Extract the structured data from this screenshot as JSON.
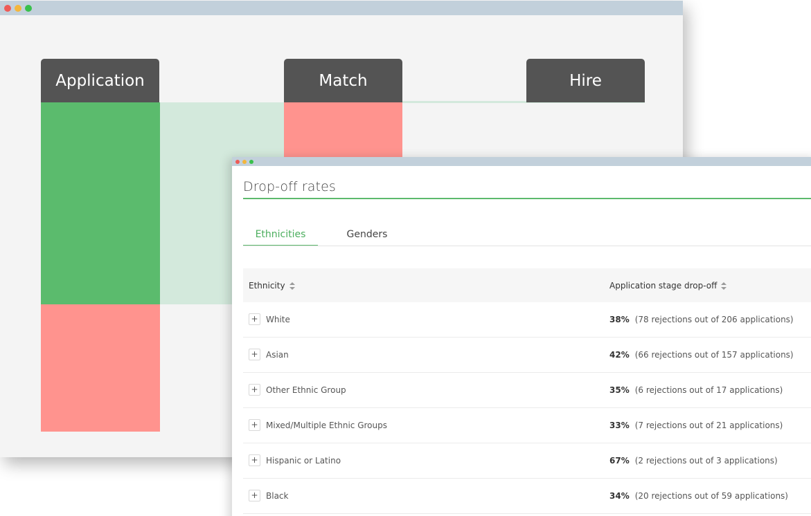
{
  "back_window": {
    "controls": {
      "close_color": "#ee5b57",
      "minimize_color": "#f4b63c",
      "zoom_color": "#39c04c"
    },
    "stages": [
      "Application",
      "Match",
      "Hire"
    ],
    "colors": {
      "tab": "#545454",
      "pass": "#5bbb6d",
      "flow": "#d3e9dc",
      "drop": "#ff938e"
    }
  },
  "front_window": {
    "title": "Drop-off rates",
    "tabs": [
      {
        "label": "Ethnicities",
        "active": true
      },
      {
        "label": "Genders",
        "active": false
      }
    ],
    "table": {
      "columns": [
        "Ethnicity",
        "Application stage drop-off"
      ],
      "expand_glyph": "+",
      "rows": [
        {
          "name": "White",
          "percent": "38%",
          "detail": "(78 rejections out of 206 applications)"
        },
        {
          "name": "Asian",
          "percent": "42%",
          "detail": "(66 rejections out of 157 applications)"
        },
        {
          "name": "Other Ethnic Group",
          "percent": "35%",
          "detail": "(6 rejections out of 17 applications)"
        },
        {
          "name": "Mixed/Multiple Ethnic Groups",
          "percent": "33%",
          "detail": "(7 rejections out of 21 applications)"
        },
        {
          "name": "Hispanic or Latino",
          "percent": "67%",
          "detail": "(2 rejections out of 3 applications)"
        },
        {
          "name": "Black",
          "percent": "34%",
          "detail": "(20 rejections out of 59 applications)"
        }
      ]
    }
  }
}
